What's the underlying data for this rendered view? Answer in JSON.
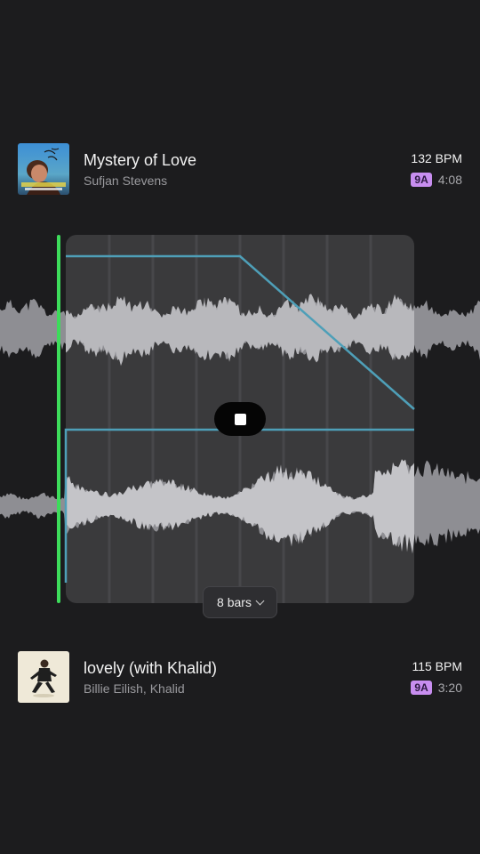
{
  "tracks": [
    {
      "title": "Mystery of Love",
      "artist": "Sufjan Stevens",
      "bpm": "132 BPM",
      "key": "9A",
      "duration": "4:08",
      "cover_icon": "album-art-mystery-of-love"
    },
    {
      "title": "lovely (with Khalid)",
      "artist": "Billie Eilish, Khalid",
      "bpm": "115 BPM",
      "key": "9A",
      "duration": "3:20",
      "cover_icon": "album-art-lovely"
    }
  ],
  "transition": {
    "length_label": "8 bars",
    "stop_icon": "stop-icon",
    "playhead_color": "#3ddc5b",
    "automation_color": "#4e9fb8",
    "key_badge_color": "#c88ef0"
  }
}
